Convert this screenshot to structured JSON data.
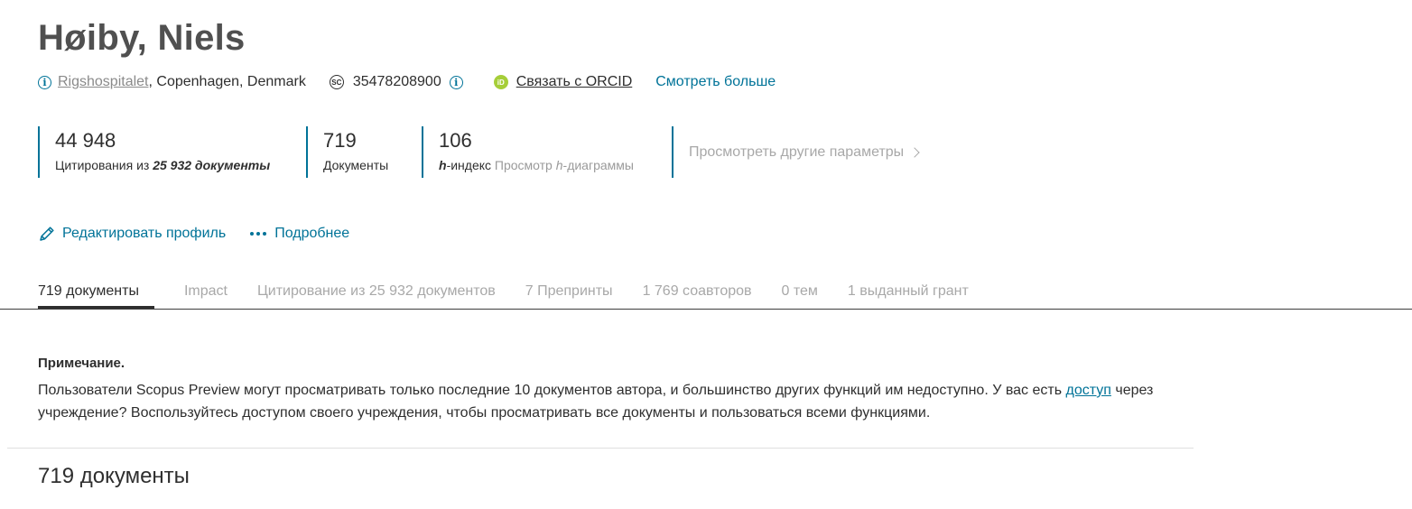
{
  "author": {
    "name": "Høiby, Niels"
  },
  "meta": {
    "affiliation_link": "Rigshospitalet",
    "affiliation_rest": ", Copenhagen, Denmark",
    "scopus_icon": "SC",
    "scopus_id": "35478208900",
    "orcid_icon": "iD",
    "orcid_link": "Связать с ORCID",
    "see_more": "Смотреть больше"
  },
  "metrics": {
    "citations": {
      "value": "44 948",
      "label_prefix": "Цитирования из ",
      "label_docs": "25 932 документы"
    },
    "documents": {
      "value": "719",
      "label": "Документы"
    },
    "h_index": {
      "value": "106",
      "label_h": "h",
      "label_rest": "-индекс",
      "view_prefix": "Просмотр ",
      "view_h": "h",
      "view_rest": "-диаграммы"
    },
    "more": "Просмотреть другие параметры"
  },
  "actions": {
    "edit_profile": "Редактировать профиль",
    "more_details": "Подробнее"
  },
  "tabs": [
    {
      "label": "719 документы",
      "active": true
    },
    {
      "label": "Impact"
    },
    {
      "label": "Цитирование из 25 932 документов"
    },
    {
      "label": "7 Препринты"
    },
    {
      "label": "1 769 соавторов"
    },
    {
      "label": "0 тем"
    },
    {
      "label": "1 выданный грант"
    }
  ],
  "note": {
    "title": "Примечание.",
    "text_before_link": "Пользователи Scopus Preview могут просматривать только последние 10 документов автора, и большинство других функций им недоступно. У вас есть ",
    "link": "доступ",
    "text_after_link": " через учреждение? Воспользуйтесь доступом своего учреждения, чтобы просматривать все документы и пользоваться всеми функциями."
  },
  "documents_heading": "719 документы",
  "colors": {
    "accent": "#007398",
    "orcid": "#a6ce39",
    "muted": "#a8a8a8"
  }
}
